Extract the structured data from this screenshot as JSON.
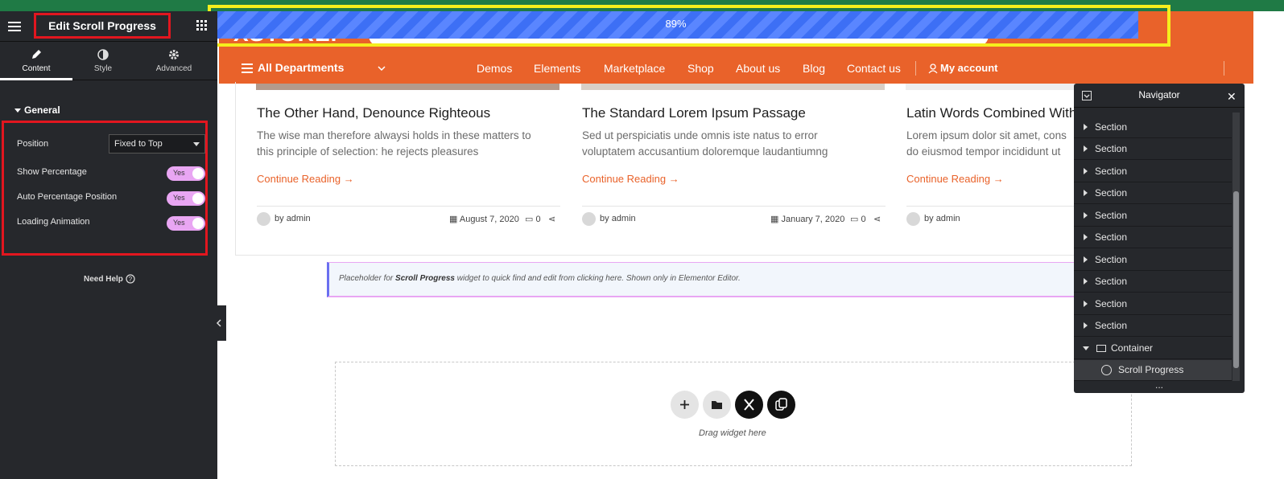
{
  "panel": {
    "title": "Edit Scroll Progress",
    "tabs": [
      {
        "label": "Content",
        "icon": "pencil-icon"
      },
      {
        "label": "Style",
        "icon": "half-circle-icon"
      },
      {
        "label": "Advanced",
        "icon": "gear-icon"
      }
    ],
    "section": "General",
    "controls": {
      "position_label": "Position",
      "position_value": "Fixed to Top",
      "show_percentage_label": "Show Percentage",
      "auto_percentage_label": "Auto Percentage Position",
      "loading_animation_label": "Loading Animation",
      "toggle_yes": "Yes"
    },
    "help": "Need Help"
  },
  "site": {
    "logo": "XSTORE.",
    "departments": "All Departments",
    "nav": [
      "Demos",
      "Elements",
      "Marketplace",
      "Shop",
      "About us",
      "Blog",
      "Contact us"
    ],
    "account": "My account"
  },
  "progress": {
    "label": "89%",
    "percent": 89,
    "color": "#3d6ff5"
  },
  "cards": [
    {
      "title": "The Other Hand, Denounce Righteous",
      "excerpt1": "The wise man therefore alwaysi holds in these matters to",
      "excerpt2": "this principle of selection: he rejects pleasures",
      "cta": "Continue Reading",
      "author": "admin",
      "date": "August 7, 2020",
      "comments": "0"
    },
    {
      "title": "The Standard Lorem Ipsum Passage",
      "excerpt1": "Sed ut perspiciatis unde omnis iste natus to error",
      "excerpt2": "voluptatem accusantium doloremque laudantiumng",
      "cta": "Continue Reading",
      "author": "admin",
      "date": "January 7, 2020",
      "comments": "0"
    },
    {
      "title": "Latin Words Combined With",
      "excerpt1": "Lorem ipsum dolor sit amet, cons",
      "excerpt2": "do eiusmod tempor incididunt ut",
      "cta": "Continue Reading",
      "author": "admin"
    }
  ],
  "by": "by",
  "placeholder": {
    "prefix": "Placeholder for",
    "bold": "Scroll Progress",
    "suffix": "widget to quick find and edit from clicking here. Shown only in Elementor Editor."
  },
  "dropzone": {
    "text": "Drag widget here"
  },
  "navigator": {
    "title": "Navigator",
    "sections": [
      "Section",
      "Section",
      "Section",
      "Section",
      "Section",
      "Section",
      "Section",
      "Section",
      "Section",
      "Section"
    ],
    "container": "Container",
    "widget": "Scroll Progress",
    "more": "..."
  },
  "colors": {
    "accent": "#e9622a",
    "panel": "#26282c",
    "highlight_red": "#e2161f",
    "highlight_yellow": "#f5ee1d",
    "toggle": "#e9a6f3"
  }
}
